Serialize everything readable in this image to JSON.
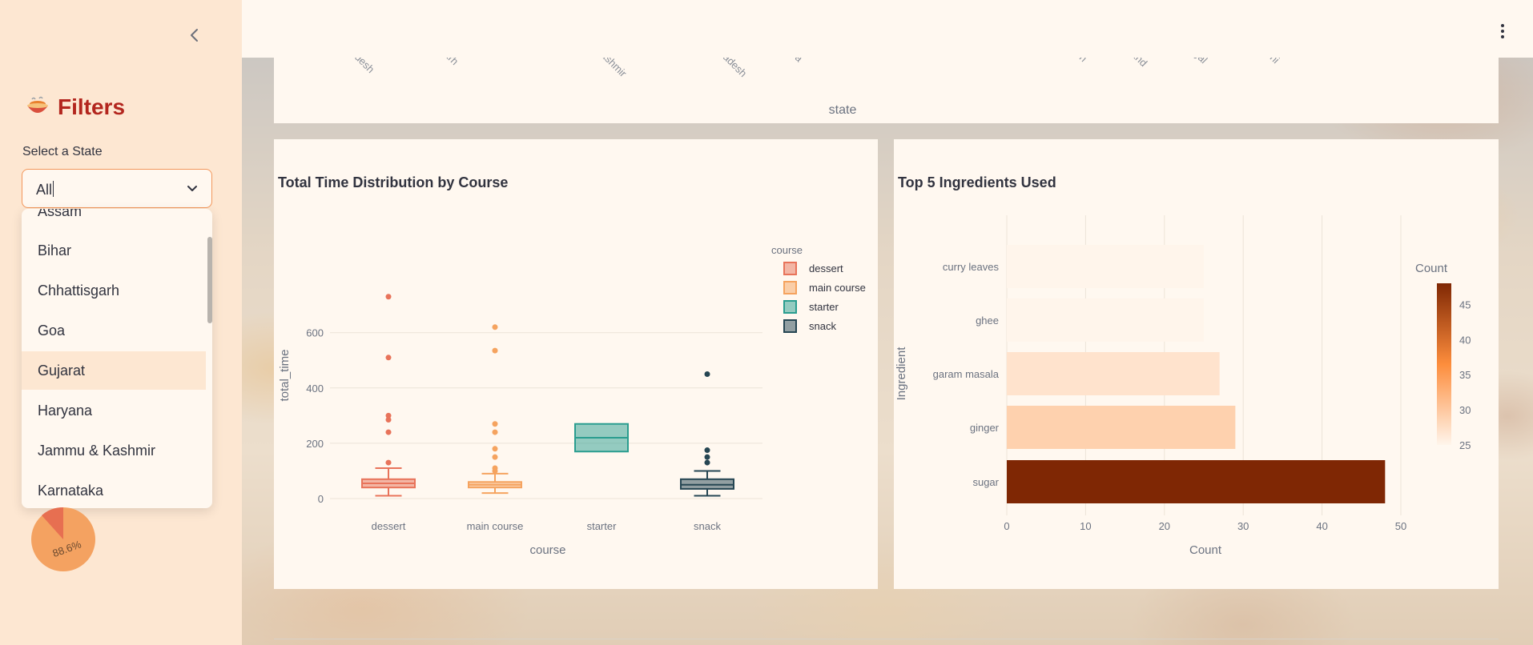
{
  "sidebar": {
    "title": "Filters",
    "select_label": "Select a State",
    "select_value": "All",
    "options": [
      "Assam",
      "Bihar",
      "Chhattisgarh",
      "Goa",
      "Gujarat",
      "Haryana",
      "Jammu & Kashmir",
      "Karnataka"
    ],
    "highlighted_option": "Gujarat",
    "pie_label": "88.6%"
  },
  "top_chart": {
    "xlabel": "state",
    "tick_fragments": [
      "adesh",
      "arh",
      ". Kashmir",
      "radesh",
      "tra",
      "sh",
      "and",
      "gal",
      "lhi"
    ]
  },
  "colors": {
    "dessert": "#e8735a",
    "main_course": "#f5a35f",
    "starter": "#2a9d8f",
    "snack": "#264653",
    "heat_low": "#fff5eb",
    "heat_high": "#7f2704",
    "accent": "#b3261e"
  },
  "chart_data": [
    {
      "type": "box",
      "title": "Total Time Distribution by Course",
      "xlabel": "course",
      "ylabel": "total_time",
      "legend_title": "course",
      "legend_position": "top-right",
      "categories": [
        "dessert",
        "main course",
        "starter",
        "snack"
      ],
      "y_ticks": [
        0,
        200,
        400,
        600
      ],
      "ylim": [
        -30,
        760
      ],
      "series": [
        {
          "name": "dessert",
          "min": 10,
          "q1": 40,
          "median": 55,
          "q3": 70,
          "max": 110,
          "outliers": [
            130,
            240,
            285,
            300,
            510,
            730
          ]
        },
        {
          "name": "main course",
          "min": 20,
          "q1": 40,
          "median": 50,
          "q3": 60,
          "max": 90,
          "outliers": [
            100,
            110,
            150,
            180,
            240,
            270,
            535,
            620
          ]
        },
        {
          "name": "starter",
          "min": 170,
          "q1": 170,
          "median": 220,
          "q3": 270,
          "max": 270,
          "outliers": []
        },
        {
          "name": "snack",
          "min": 10,
          "q1": 35,
          "median": 50,
          "q3": 70,
          "max": 100,
          "outliers": [
            130,
            150,
            175,
            450
          ]
        }
      ]
    },
    {
      "type": "bar",
      "orientation": "horizontal",
      "title": "Top 5 Ingredients Used",
      "xlabel": "Count",
      "ylabel": "Ingredient",
      "categories": [
        "curry leaves",
        "ghee",
        "garam masala",
        "ginger",
        "sugar"
      ],
      "values": [
        25,
        25,
        27,
        29,
        48
      ],
      "x_ticks": [
        0,
        10,
        20,
        30,
        40,
        50
      ],
      "xlim": [
        0,
        50
      ],
      "colorbar": {
        "title": "Count",
        "range": [
          25,
          48
        ],
        "ticks": [
          25,
          30,
          35,
          40,
          45
        ]
      }
    }
  ]
}
